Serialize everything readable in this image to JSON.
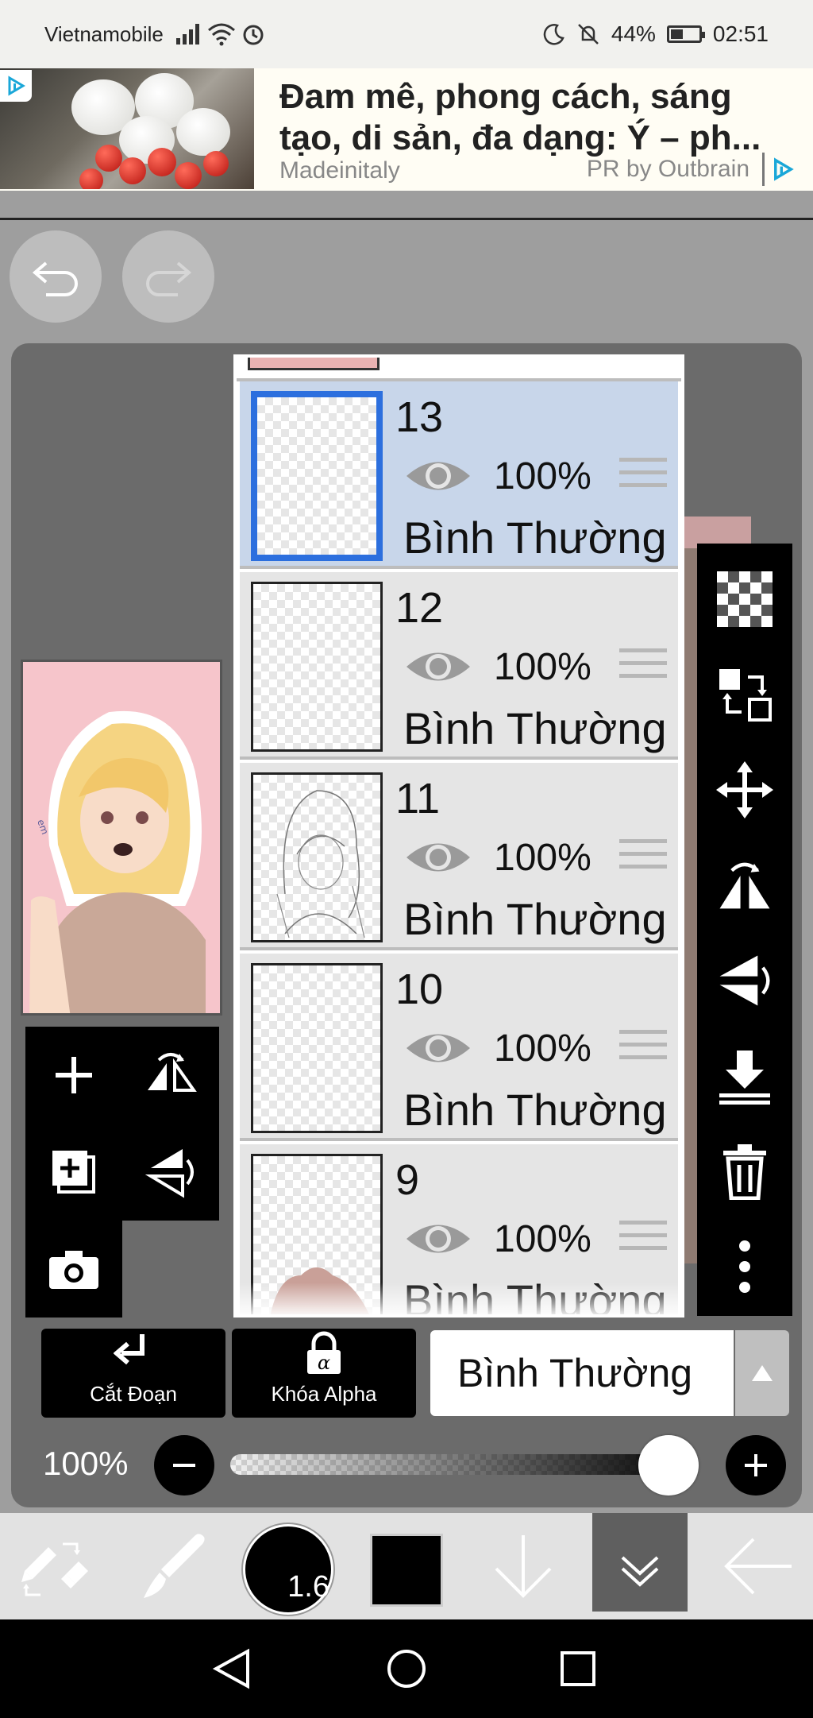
{
  "status_bar": {
    "carrier": "Vietnamobile",
    "battery": "44%",
    "time": "02:51"
  },
  "ad": {
    "title": "Đam mê, phong cách, sáng tạo, di sản, đa dạng: Ý – ph...",
    "source": "Madeinitaly",
    "provider": "PR by Outbrain"
  },
  "layers": [
    {
      "number": "13",
      "opacity": "100%",
      "blend": "Bình Thường",
      "selected": true
    },
    {
      "number": "12",
      "opacity": "100%",
      "blend": "Bình Thường",
      "selected": false
    },
    {
      "number": "11",
      "opacity": "100%",
      "blend": "Bình Thường",
      "selected": false
    },
    {
      "number": "10",
      "opacity": "100%",
      "blend": "Bình Thường",
      "selected": false
    },
    {
      "number": "9",
      "opacity": "100%",
      "blend": "Bình Thường",
      "selected": false
    }
  ],
  "controls": {
    "clipping_label": "Cắt Đoạn",
    "alpha_lock_label": "Khóa Alpha",
    "blend_mode": "Bình Thường",
    "opacity_label": "100%",
    "opacity_value": 1.0
  },
  "toolbar": {
    "brush_size": "1.6",
    "color": "#000000"
  },
  "colors": {
    "selection": "#2c6fde",
    "selected_row": "#c8d6ea"
  }
}
